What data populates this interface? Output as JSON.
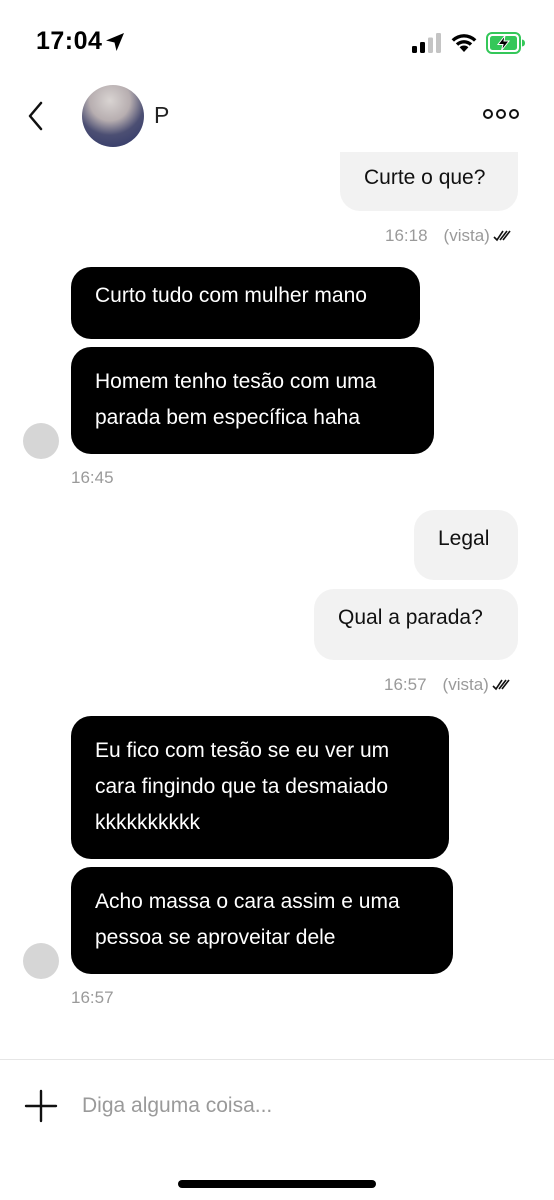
{
  "status_bar": {
    "time": "17:04",
    "icons": [
      "location-arrow-icon",
      "signal-icon",
      "wifi-icon",
      "battery-charging-icon"
    ]
  },
  "header": {
    "contact_name": "P",
    "icons": [
      "back-chevron-icon",
      "more-dots-icon"
    ]
  },
  "messages": [
    {
      "direction": "out",
      "text": "Curte o que?"
    },
    {
      "direction": "in",
      "text": "Curto tudo com mulher mano"
    },
    {
      "direction": "in",
      "lines": [
        "Homem tenho tesão com uma",
        "parada bem específica haha"
      ]
    },
    {
      "direction": "out",
      "text": "Legal"
    },
    {
      "direction": "out",
      "text": "Qual a parada?"
    },
    {
      "direction": "in",
      "lines": [
        "Eu fico com tesão se eu ver um",
        "cara fingindo que ta desmaiado",
        "kkkkkkkkkk"
      ]
    },
    {
      "direction": "in",
      "lines": [
        "Acho massa o cara assim e uma",
        "pessoa se aproveitar dele"
      ]
    }
  ],
  "meta": {
    "out_group_1": {
      "time": "16:18",
      "status": "(vista)"
    },
    "in_group_1": {
      "time": "16:45"
    },
    "out_group_2": {
      "time": "16:57",
      "status": "(vista)"
    },
    "in_group_2": {
      "time": "16:57"
    }
  },
  "composer": {
    "placeholder": "Diga alguma coisa...",
    "value": ""
  },
  "colors": {
    "incoming_bubble": "#000000",
    "outgoing_bubble": "#f2f2f2",
    "battery_green": "#34c759",
    "meta_text": "#9a9a9a"
  }
}
